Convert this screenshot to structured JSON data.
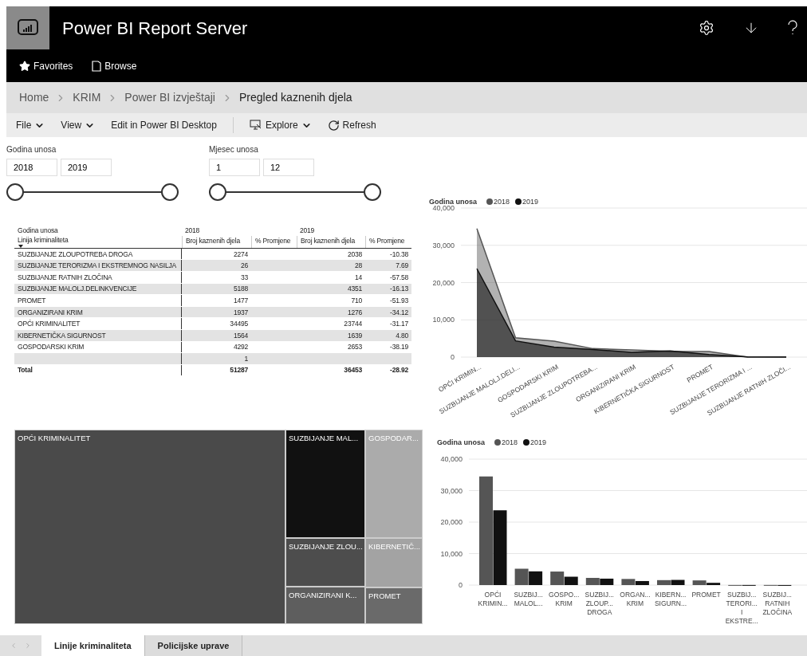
{
  "header": {
    "title": "Power BI Report Server",
    "nav": [
      {
        "label": "Favorites",
        "kind": "star"
      },
      {
        "label": "Browse",
        "kind": "browse"
      }
    ]
  },
  "breadcrumb": [
    "Home",
    "KRIM",
    "Power BI izvještaji",
    "Pregled kaznenih djela"
  ],
  "toolbar": [
    {
      "label": "File",
      "kind": "menu"
    },
    {
      "label": "View",
      "kind": "menu"
    },
    {
      "label": "Edit in Power BI Desktop",
      "kind": "plain"
    },
    {
      "label": "Explore",
      "kind": "explore"
    },
    {
      "label": "Refresh",
      "kind": "refresh"
    }
  ],
  "slicers": [
    {
      "title": "Godina unosa",
      "from": "2018",
      "to": "2019",
      "thumbs": [
        {
          "level": 0
        },
        {
          "level": 1
        }
      ]
    },
    {
      "title": "Mjesec unosa",
      "from": "1",
      "to": "12",
      "thumbs": [
        {
          "level": 0
        },
        {
          "level": 1
        }
      ]
    }
  ],
  "table": {
    "group_label": "Godina unosa",
    "row_header": "Linija kriminaliteta",
    "years": [
      "2018",
      "2019"
    ],
    "columns": [
      "Broj kaznenih djela",
      "% Promjene",
      "Broj kaznenih djela",
      "% Promjene"
    ],
    "rows": [
      {
        "name": "SUZBIJANJE ZLOUPOTREBA DROGA",
        "count_2018": "2274",
        "count_2019": "2038",
        "change_2019": "-10.38"
      },
      {
        "name": "SUZBIJANJE TERORIZMA I EKSTREMNOG NASILJA",
        "count_2018": "26",
        "count_2019": "28",
        "change_2019": "7.69"
      },
      {
        "name": "SUZBIJANJE RATNIH ZLOČINA",
        "count_2018": "33",
        "count_2019": "14",
        "change_2019": "-57.58"
      },
      {
        "name": "SUZBIJANJE MALOLJ.DELINKVENCIJE",
        "count_2018": "5188",
        "count_2019": "4351",
        "change_2019": "-16.13"
      },
      {
        "name": "PROMET",
        "count_2018": "1477",
        "count_2019": "710",
        "change_2019": "-51.93"
      },
      {
        "name": "ORGANIZIRANI KRIM",
        "count_2018": "1937",
        "count_2019": "1276",
        "change_2019": "-34.12"
      },
      {
        "name": "OPĆI KRIMINALITET",
        "count_2018": "34495",
        "count_2019": "23744",
        "change_2019": "-31.17"
      },
      {
        "name": "KIBERNETIČKA SIGURNOST",
        "count_2018": "1564",
        "count_2019": "1639",
        "change_2019": "4.80"
      },
      {
        "name": "GOSPODARSKI KRIM",
        "count_2018": "4292",
        "count_2019": "2653",
        "change_2019": "-38.19"
      },
      {
        "count_2018": "1"
      }
    ],
    "total": {
      "name": "Total",
      "count_2018": "51287",
      "count_2019": "36453",
      "change_2019": "-28.92"
    }
  },
  "area_chart": {
    "legend_title": "Godina unosa",
    "chart_data": {
      "type": "area",
      "grid": true,
      "legend": "top-left",
      "categories": [
        "OPĆI KRIMIN...",
        "SUZBIJANJE MALOLJ.DELI...",
        "GOSPODARSKI KRIM",
        "SUZBIJANJE ZLOUPOTREBA...",
        "ORGANIZIRANI KRIM",
        "KIBERNETIČKA SIGURNOST",
        "PROMET",
        "SUZBIJANJE TERORIZMA I ...",
        "SUZBIJANJE RATNIH ZLOČI..."
      ],
      "series": [
        {
          "name": "2018",
          "color": "#555555",
          "values": [
            34495,
            5188,
            4292,
            2274,
            1937,
            1564,
            1477,
            26,
            33
          ]
        },
        {
          "name": "2019",
          "color": "#111111",
          "values": [
            23744,
            4351,
            2653,
            2038,
            1276,
            1639,
            710,
            28,
            14
          ]
        }
      ],
      "ylim": [
        0,
        40000
      ],
      "yticks": [
        {
          "value": 0,
          "label": "0"
        },
        {
          "value": 10000,
          "label": "10,000"
        },
        {
          "value": 20000,
          "label": "20,000"
        },
        {
          "value": 30000,
          "label": "30,000"
        },
        {
          "value": 40000,
          "label": "40,000"
        }
      ]
    }
  },
  "treemap": [
    {
      "label": "OPĆI KRIMINALITET",
      "color": "#4a4a4a"
    },
    {
      "label": "SUZBIJANJE MAL...",
      "color": "#111111"
    },
    {
      "label": "SUZBIJANJE ZLOU...",
      "color": "#4d4d4d"
    },
    {
      "label": "ORGANIZIRANI K...",
      "color": "#5e5e5e"
    },
    {
      "label": "GOSPODAR...",
      "color": "#ababab"
    },
    {
      "label": "KIBERNETIČ...",
      "color": "#a3a3a3"
    },
    {
      "label": "PROMET",
      "color": "#6a6a6a"
    }
  ],
  "bar_chart": {
    "legend_title": "Godina unosa",
    "chart_data": {
      "type": "bar",
      "grid": true,
      "legend": "top-left",
      "categories": [
        "OPĆI KRIMIN...",
        "SUZBIJ... MALOL...",
        "GOSPO... KRIM",
        "SUZBIJ... ZLOUP... DROGA",
        "ORGAN... KRIM",
        "KIBERN... SIGURN...",
        "PROMET",
        "SUZBIJ... TERORI... I EKSTRE...",
        "SUZBIJ... RATNIH ZLOČINA"
      ],
      "series": [
        {
          "name": "2018",
          "color": "#555555",
          "values": [
            34495,
            5188,
            4292,
            2274,
            1937,
            1564,
            1477,
            26,
            33
          ]
        },
        {
          "name": "2019",
          "color": "#111111",
          "values": [
            23744,
            4351,
            2653,
            2038,
            1276,
            1639,
            710,
            28,
            14
          ]
        }
      ],
      "ylim": [
        0,
        40000
      ],
      "yticks": [
        {
          "value": 0,
          "label": "0"
        },
        {
          "value": 10000,
          "label": "10,000"
        },
        {
          "value": 20000,
          "label": "20,000"
        },
        {
          "value": 30000,
          "label": "30,000"
        },
        {
          "value": 40000,
          "label": "40,000"
        }
      ]
    }
  },
  "pages": [
    {
      "label": "Linije kriminaliteta",
      "selected": true
    },
    {
      "label": "Policijske uprave",
      "selected": false
    }
  ]
}
